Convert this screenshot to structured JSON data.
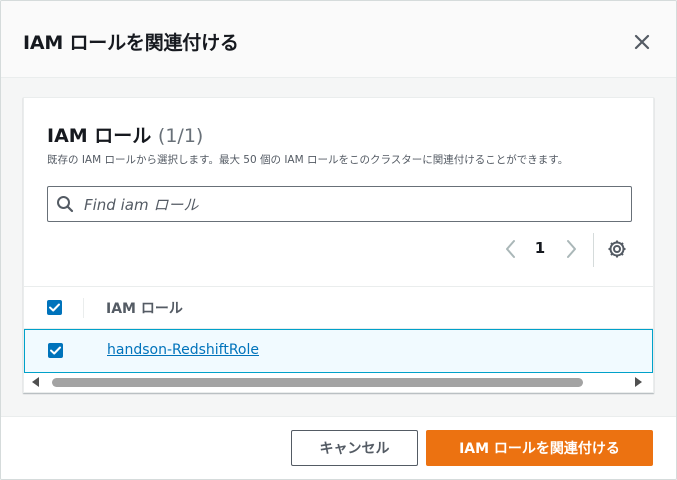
{
  "modal": {
    "title": "IAM ロールを関連付ける",
    "close_icon": "close-icon"
  },
  "panel": {
    "title": "IAM ロール",
    "count": "(1/1)",
    "description": "既存の IAM ロールから選択します。最大 50 個の IAM ロールをこのクラスターに関連付けることができます。"
  },
  "search": {
    "placeholder": "Find iam ロール",
    "value": "",
    "icon": "search-icon"
  },
  "pagination": {
    "current_page": "1",
    "prev_icon": "chevron-left-icon",
    "next_icon": "chevron-right-icon",
    "settings_icon": "gear-icon"
  },
  "table": {
    "columns": [
      "IAM ロール"
    ],
    "select_all_checked": true,
    "rows": [
      {
        "role_name": "handson-RedshiftRole",
        "checked": true
      }
    ]
  },
  "footer": {
    "cancel_label": "キャンセル",
    "confirm_label": "IAM ロールを関連付ける"
  },
  "colors": {
    "accent_orange": "#ec7211",
    "link_blue": "#0073bb",
    "checkbox_blue": "#0073bb",
    "selected_row_bg": "#f1faff",
    "selected_row_border": "#00a1c9"
  }
}
